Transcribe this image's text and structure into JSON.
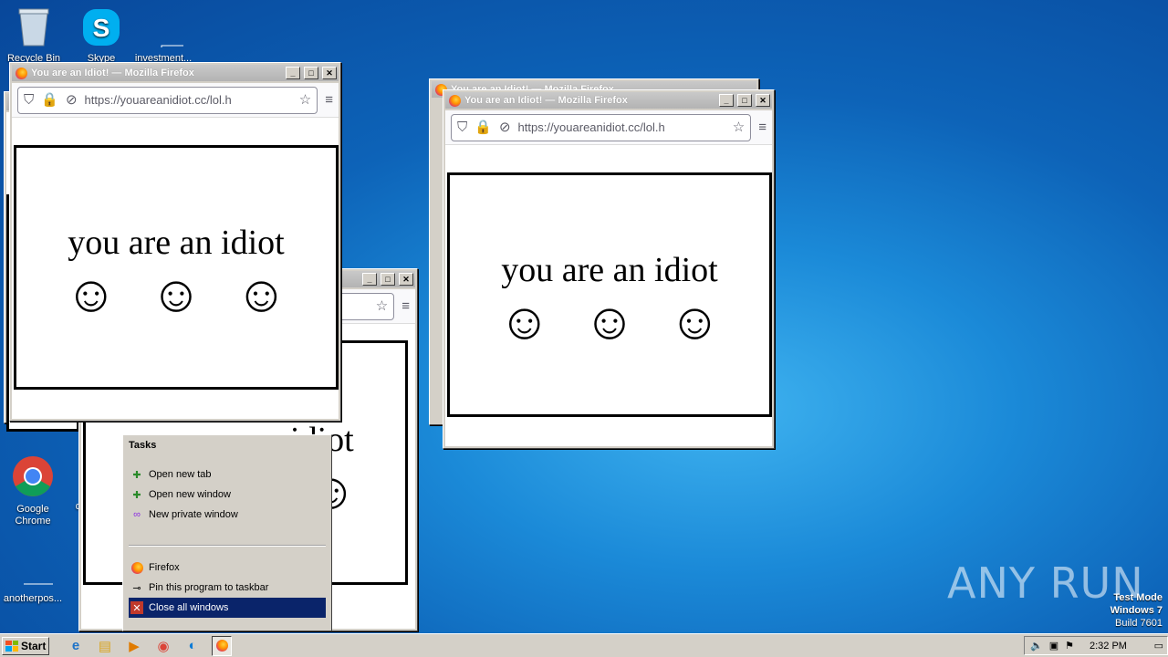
{
  "desktop": {
    "icons": [
      {
        "label": "Recycle Bin",
        "icon": "recycle-bin-icon"
      },
      {
        "label": "Skype",
        "icon": "skype-icon"
      },
      {
        "label": "investment...",
        "icon": "document-icon"
      },
      {
        "label": "Google Chrome",
        "icon": "chrome-icon"
      },
      {
        "label": "di",
        "icon": "document-icon"
      },
      {
        "label": "anotherpos...",
        "icon": "document-icon"
      }
    ]
  },
  "firefox_window": {
    "title": "You are an Idiot! — Mozilla Firefox",
    "url": "https://youareanidiot.cc/lol.h",
    "page_text": "you are an idiot",
    "smileys": [
      "☺",
      "☺",
      "☺"
    ],
    "partial_text": "iot"
  },
  "jumplist": {
    "heading": "Tasks",
    "tasks": [
      "Open new tab",
      "Open new window",
      "New private window"
    ],
    "app_name": "Firefox",
    "pin_label": "Pin this program to taskbar",
    "close_label": "Close all windows"
  },
  "taskbar": {
    "start_label": "Start",
    "clock": "2:32 PM"
  },
  "watermark": "ANY RUN",
  "test_mode": {
    "line1": "Test Mode",
    "line2": "Windows 7",
    "line3": "Build 7601"
  }
}
